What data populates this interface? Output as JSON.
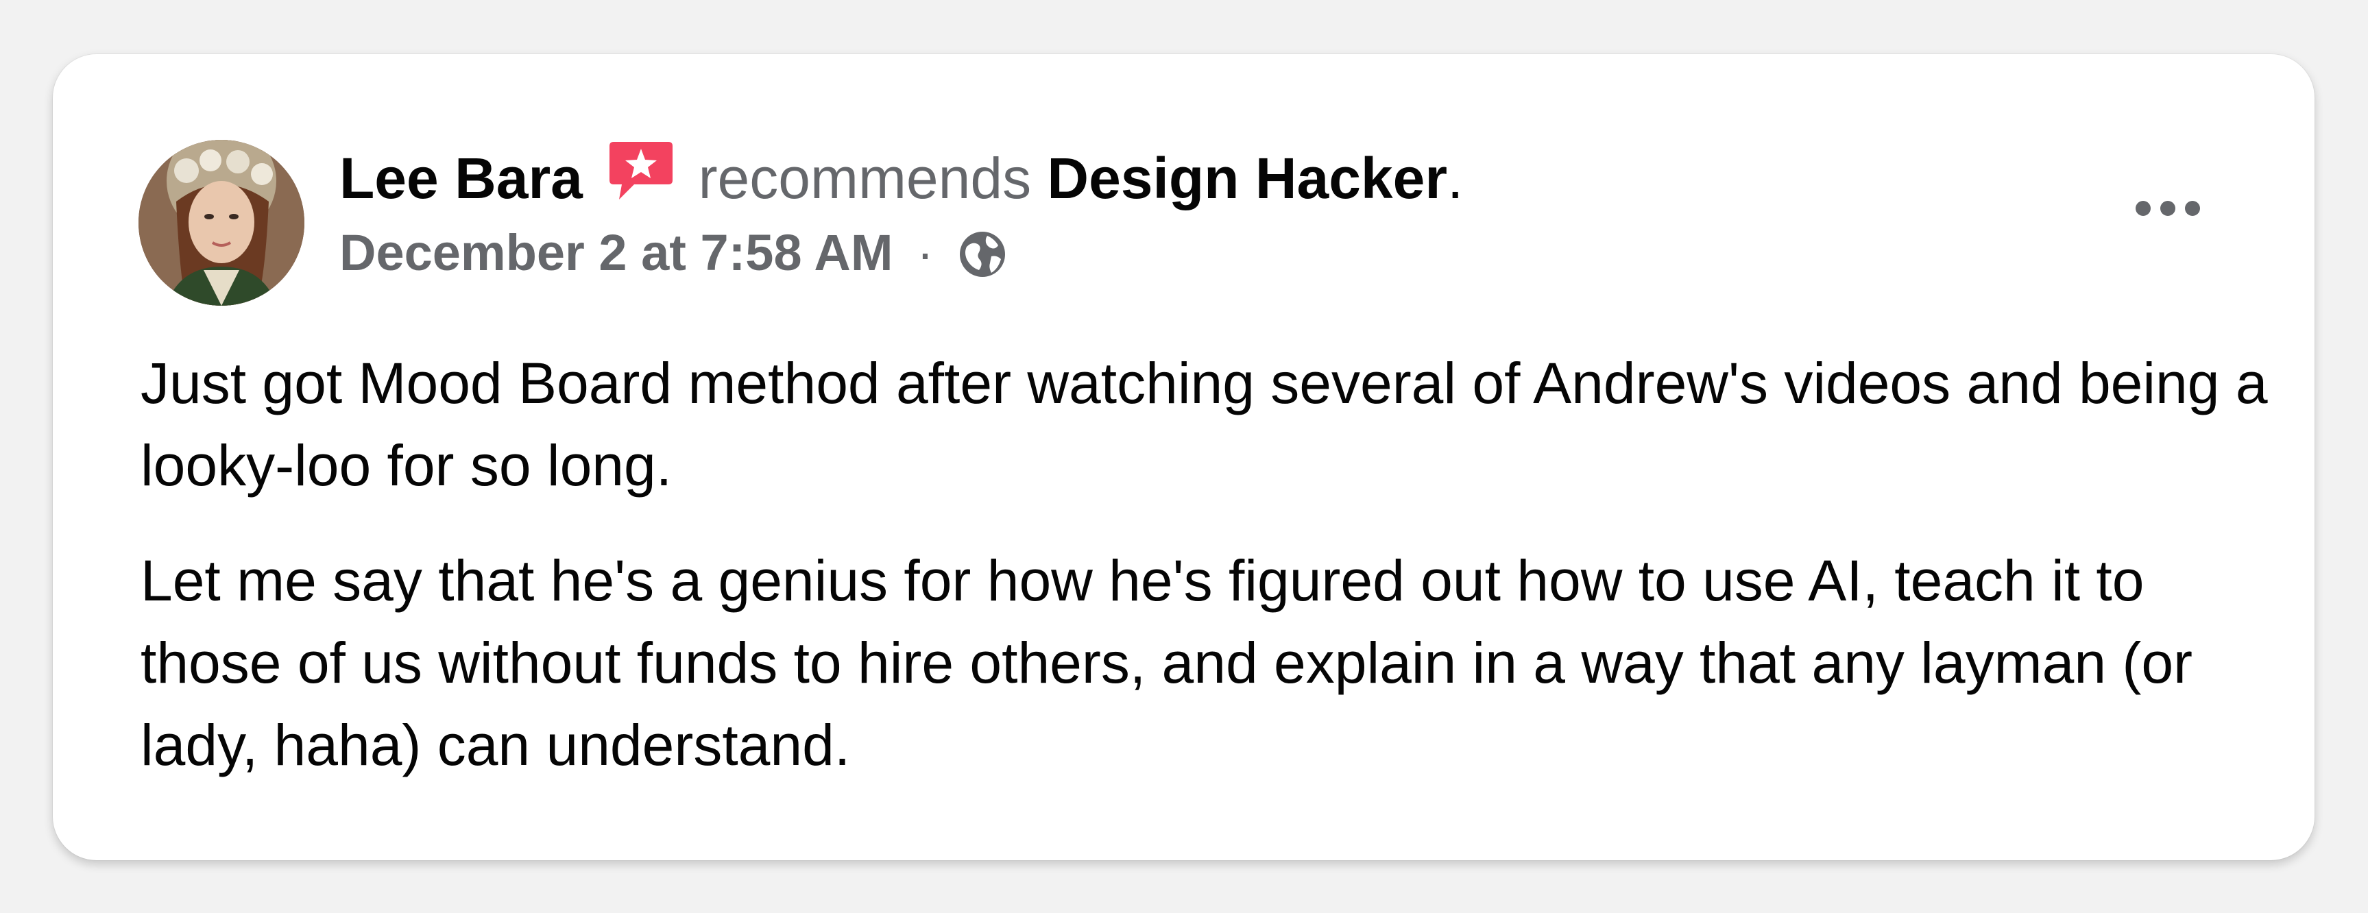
{
  "post": {
    "author_name": "Lee Bara",
    "recommends_text": "recommends",
    "page_name": "Design Hacker",
    "period": ".",
    "timestamp": "December 2 at 7:58 AM",
    "separator": "·",
    "privacy_icon": "globe-icon",
    "recommendation_icon": "recommendation-badge-icon",
    "more_icon": "more-options-icon",
    "paragraphs": [
      "Just got Mood Board method after watching several of Andrew's videos and being a looky-loo for so long.",
      "Let me say that he's a genius for how he's figured out how to use AI, teach it to those of us without funds to hire others, and explain in a way that any layman (or lady, haha) can understand."
    ],
    "colors": {
      "primary_text": "#050505",
      "secondary_text": "#65676b",
      "recommend_badge": "#f3425f",
      "card_background": "#ffffff",
      "page_background": "#f2f2f2"
    }
  }
}
